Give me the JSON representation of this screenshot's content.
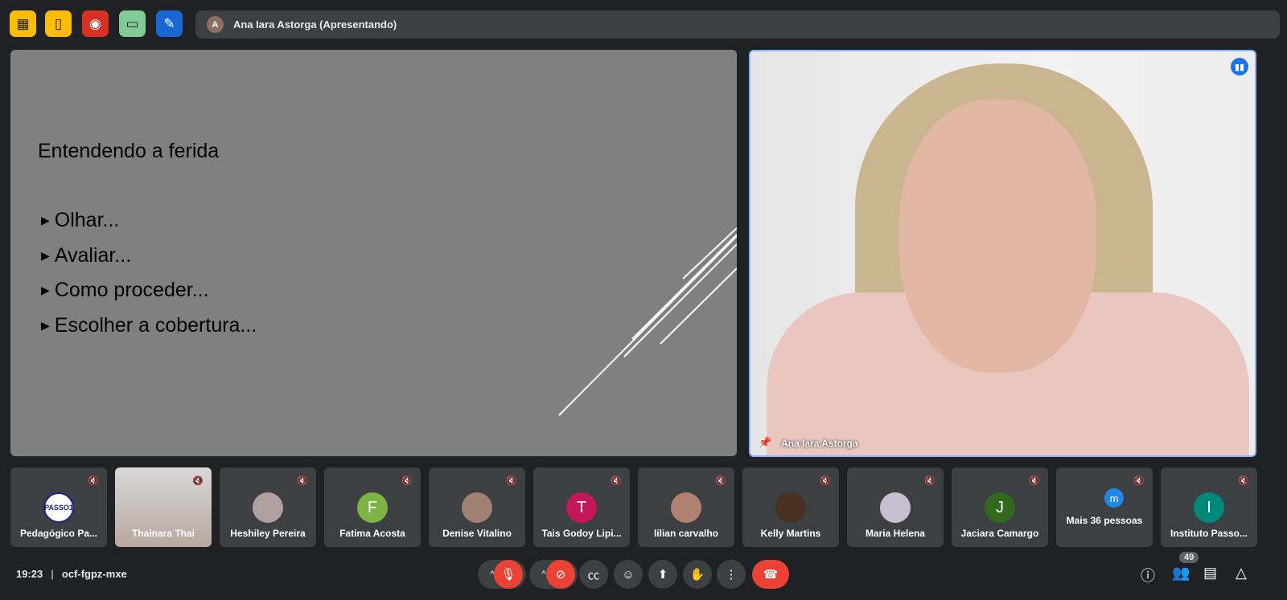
{
  "toolbar": {
    "icons": [
      "hide-icon",
      "door-icon",
      "record-icon",
      "devices-icon",
      "whiteboard-icon"
    ],
    "colors": [
      "#fbbc04",
      "#fbbc04",
      "#d93025",
      "#81c995",
      "#1967d2"
    ]
  },
  "presenting": {
    "avatar": "A",
    "label": "Ana Iara Astorga (Apresentando)"
  },
  "slide": {
    "title": "Entendendo a ferida",
    "bullets": [
      "Olhar...",
      "Avaliar...",
      "Como proceder...",
      "Escolher a cobertura..."
    ]
  },
  "video": {
    "name": "Ana Iara Astorga"
  },
  "tiles": [
    {
      "name": "Pedagógico Pa...",
      "avatar": "PASSO1",
      "color": "#ffffff"
    },
    {
      "name": "Thainara Thai",
      "avatar": "",
      "color": "#c9a894"
    },
    {
      "name": "Heshiley Pereira",
      "avatar": "",
      "color": "#b0a0a0"
    },
    {
      "name": "Fatima Acosta",
      "avatar": "F",
      "color": "#7cb342"
    },
    {
      "name": "Denise Vitalino",
      "avatar": "",
      "color": "#a08070"
    },
    {
      "name": "Tais Godoy Lipi...",
      "avatar": "T",
      "color": "#c2185b"
    },
    {
      "name": "lilian carvalho",
      "avatar": "",
      "color": "#b08070"
    },
    {
      "name": "Kelly Martins",
      "avatar": "",
      "color": "#4a3020"
    },
    {
      "name": "Maria Helena",
      "avatar": "",
      "color": "#c8c0d0"
    },
    {
      "name": "Jaciara Camargo",
      "avatar": "J",
      "color": "#33691e"
    },
    {
      "name": "Mais 36 pessoas",
      "avatar": "m",
      "color": "#1e88e5"
    },
    {
      "name": "Instituto Passo...",
      "avatar": "I",
      "color": "#00897b"
    }
  ],
  "bottom": {
    "time": "19:23",
    "code": "ocf-fgpz-mxe",
    "participants": "49"
  }
}
